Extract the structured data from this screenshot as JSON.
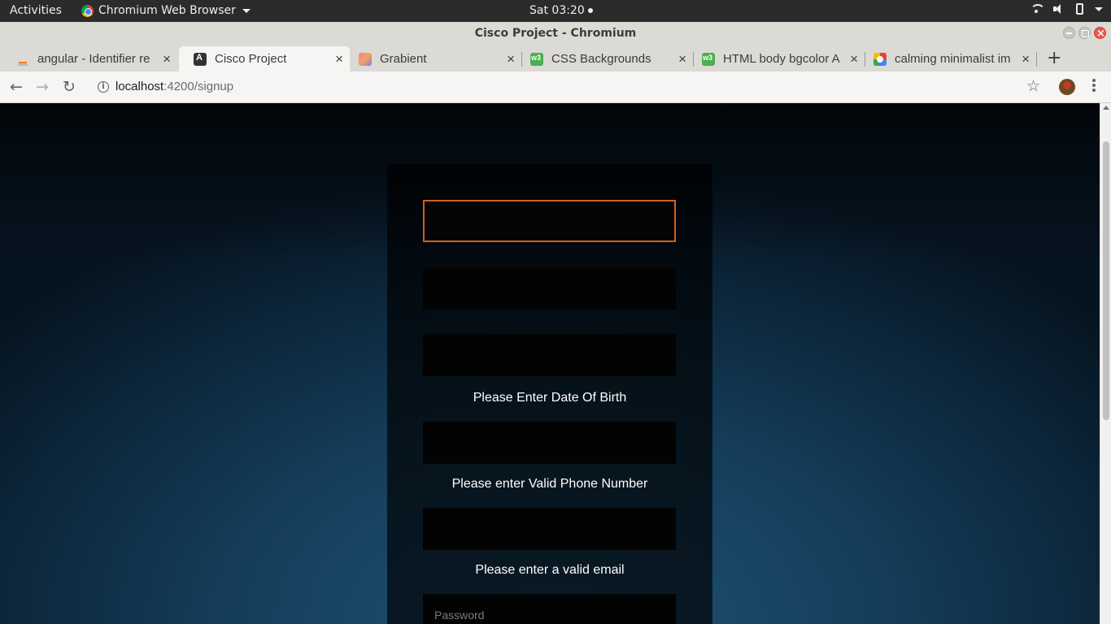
{
  "system": {
    "activities": "Activities",
    "app_name": "Chromium Web Browser",
    "clock": "Sat 03:20"
  },
  "window": {
    "title": "Cisco Project - Chromium"
  },
  "tabs": [
    {
      "title": "angular - Identifier re",
      "icon": "stackoverflow-icon"
    },
    {
      "title": "Cisco Project",
      "icon": "angular-icon",
      "active": true
    },
    {
      "title": "Grabient",
      "icon": "grabient-icon"
    },
    {
      "title": "CSS Backgrounds",
      "icon": "w3schools-icon"
    },
    {
      "title": "HTML body bgcolor A",
      "icon": "w3schools-icon"
    },
    {
      "title": "calming minimalist im",
      "icon": "google-icon"
    }
  ],
  "toolbar": {
    "url_host": "localhost",
    "url_path": ":4200/signup"
  },
  "form": {
    "dob_error": "Please Enter Date Of Birth",
    "phone_error": "Please enter Valid Phone Number",
    "email_error": "Please enter a valid email",
    "password_placeholder": "Password"
  },
  "colors": {
    "focus_border": "#d0601d",
    "page_bg": "#153d5a"
  }
}
